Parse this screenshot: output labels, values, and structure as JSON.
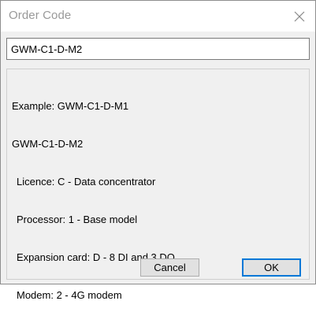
{
  "window": {
    "title": "Order Code"
  },
  "order_code_input": {
    "value": "GWM-C1-D-M2"
  },
  "info": {
    "example": "Example: GWM-C1-D-M1",
    "code": "GWM-C1-D-M2",
    "details": [
      "Licence: C - Data concentrator",
      "Processor: 1 - Base model",
      "Expansion card: D - 8 DI and 3 DO",
      "Modem: 2 - 4G modem"
    ]
  },
  "buttons": {
    "cancel_label": "Cancel",
    "ok_label": "OK"
  },
  "colors": {
    "accent_focus": "#0078d7",
    "dialog_background": "#f0f0f0",
    "title_text": "#999999"
  },
  "icons": {
    "close": "close-icon"
  }
}
